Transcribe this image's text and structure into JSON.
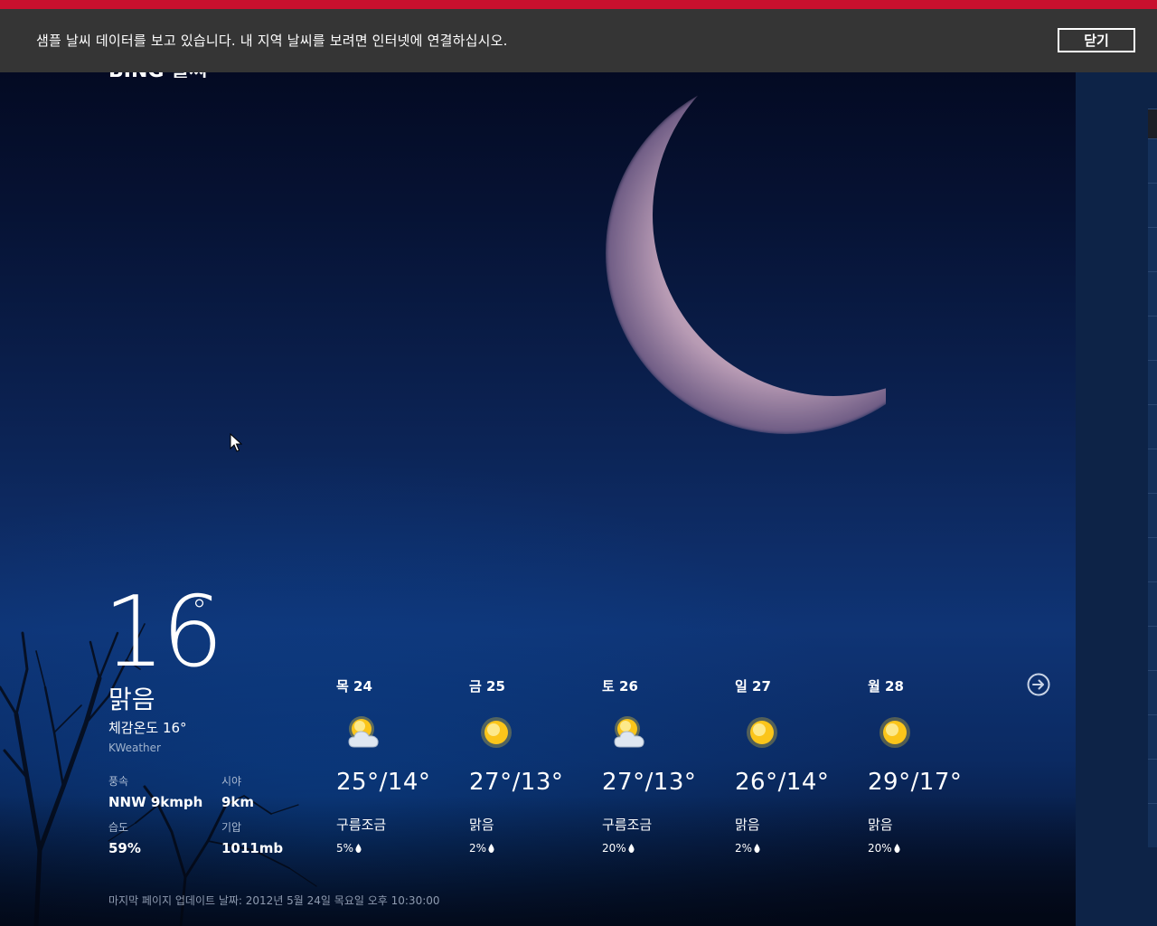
{
  "notification": {
    "message": "샘플 날씨 데이터를 보고 있습니다. 내 지역 날씨를 보려면 인터넷에 연결하십시오.",
    "close_label": "닫기"
  },
  "app": {
    "title": "BING 날씨"
  },
  "current": {
    "temperature": "16",
    "degree_symbol": "°",
    "condition": "맑음",
    "feels_like": "체감온도 16°",
    "provider": "KWeather",
    "stats": {
      "wind_label": "풍속",
      "wind_value": "NNW 9kmph",
      "visibility_label": "시야",
      "visibility_value": "9km",
      "humidity_label": "습도",
      "humidity_value": "59%",
      "pressure_label": "기압",
      "pressure_value": "1011mb"
    }
  },
  "forecast": [
    {
      "day": "목 24",
      "icon": "partly-cloudy-icon",
      "temps": "25°/14°",
      "condition": "구름조금",
      "precip": "5%"
    },
    {
      "day": "금 25",
      "icon": "sunny-icon",
      "temps": "27°/13°",
      "condition": "맑음",
      "precip": "2%"
    },
    {
      "day": "토 26",
      "icon": "partly-cloudy-icon",
      "temps": "27°/13°",
      "condition": "구름조금",
      "precip": "20%"
    },
    {
      "day": "일 27",
      "icon": "sunny-icon",
      "temps": "26°/14°",
      "condition": "맑음",
      "precip": "2%"
    },
    {
      "day": "월 28",
      "icon": "sunny-icon",
      "temps": "29°/17°",
      "condition": "맑음",
      "precip": "20%"
    }
  ],
  "footer": {
    "last_updated": "마지막 페이지 업데이트 날짜: 2012년 5월 24일 목요일 오후 10:30:00"
  },
  "colors": {
    "accent_red": "#c8102e",
    "notification_bg": "#353535",
    "side_panel": "#0d2347"
  }
}
